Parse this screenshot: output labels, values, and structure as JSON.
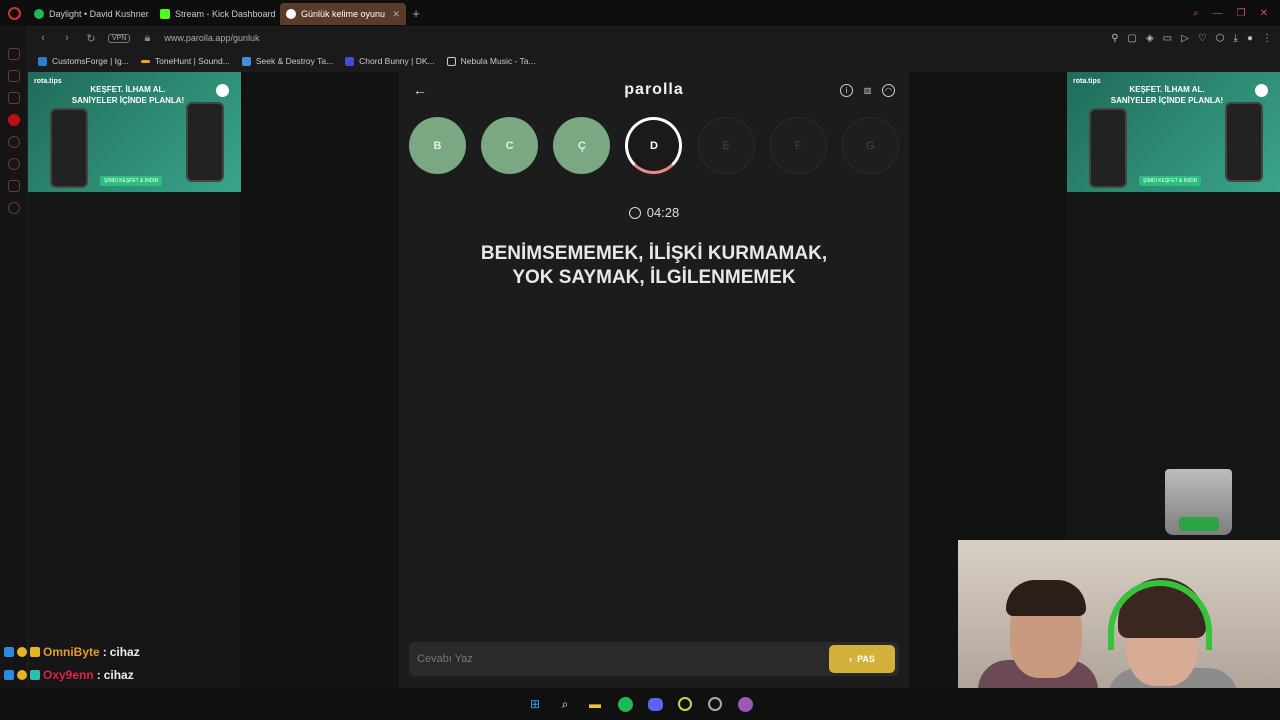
{
  "browser": {
    "tabs": [
      {
        "label": "Daylight • David Kushner",
        "color": "#1db954"
      },
      {
        "label": "Stream - Kick Dashboard",
        "color": "#53fc18"
      },
      {
        "label": "Günlük kelime oyunu",
        "color": "#ffffff",
        "active": true
      }
    ],
    "new_tab": "+",
    "vpn": "VPN",
    "url": "www.parolla.app/gunluk",
    "bookmarks": [
      {
        "label": "CustomsForge | Ig...",
        "color": "#2a7fd4"
      },
      {
        "label": "ToneHunt | Sound...",
        "color": "#f0a020"
      },
      {
        "label": "Seek & Destroy Ta...",
        "color": "#3d8fe0"
      },
      {
        "label": "Chord Bunny | DK...",
        "color": "#4a4ad0"
      },
      {
        "label": "Nebula Music - Ta...",
        "color": "#cccccc"
      }
    ]
  },
  "ads": {
    "brand": "rota.tips",
    "tagline_line1": "KEŞFET. İLHAM AL.",
    "tagline_line2": "SANİYELER İÇİNDE PLANLA!",
    "cta": "ŞİMDİ KEŞFET & İNDİR"
  },
  "game": {
    "logo": "parolla",
    "letters": [
      {
        "char": "B",
        "state": "done"
      },
      {
        "char": "C",
        "state": "done"
      },
      {
        "char": "Ç",
        "state": "done"
      },
      {
        "char": "D",
        "state": "current"
      },
      {
        "char": "E",
        "state": "todo"
      },
      {
        "char": "F",
        "state": "todo"
      },
      {
        "char": "G",
        "state": "todo"
      }
    ],
    "timer": "04:28",
    "clue_line1": "BENİMSEMEMEK, İLİŞKİ KURMAMAK,",
    "clue_line2": "YOK SAYMAK, İLGİLENMEMEK",
    "answer_placeholder": "Cevabı Yaz",
    "pass_label": "PAS"
  },
  "chat": [
    {
      "user": "OmniByte",
      "sep": ":",
      "message": "cihaz"
    },
    {
      "user": "Oxy9enn",
      "sep": ":",
      "message": "cihaz"
    }
  ]
}
